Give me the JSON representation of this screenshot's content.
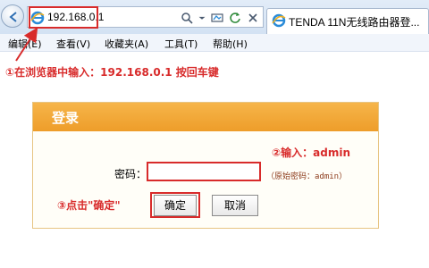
{
  "browser": {
    "address": "192.168.0.1",
    "tab_title": "TENDA 11N无线路由器登...",
    "icons": [
      "back-arrow-icon",
      "ie-logo-icon",
      "search-icon",
      "dropdown-icon",
      "refresh-icon",
      "close-icon"
    ]
  },
  "menubar": {
    "items": [
      {
        "label": "编辑(E)"
      },
      {
        "label": "查看(V)"
      },
      {
        "label": "收藏夹(A)"
      },
      {
        "label": "工具(T)"
      },
      {
        "label": "帮助(H)"
      }
    ]
  },
  "annotations": {
    "step1": "①在浏览器中输入：192.168.0.1 按回车键",
    "step2": "②输入：admin",
    "step3": "③点击\"确定\""
  },
  "login": {
    "title": "登录",
    "password_label": "密码：",
    "password_value": "",
    "hint": "（原始密码：admin）",
    "ok_label": "确定",
    "cancel_label": "取消"
  },
  "colors": {
    "annotation_red": "#d82b2b",
    "panel_header": "#f0a232",
    "chrome": "#dbe6f4"
  }
}
